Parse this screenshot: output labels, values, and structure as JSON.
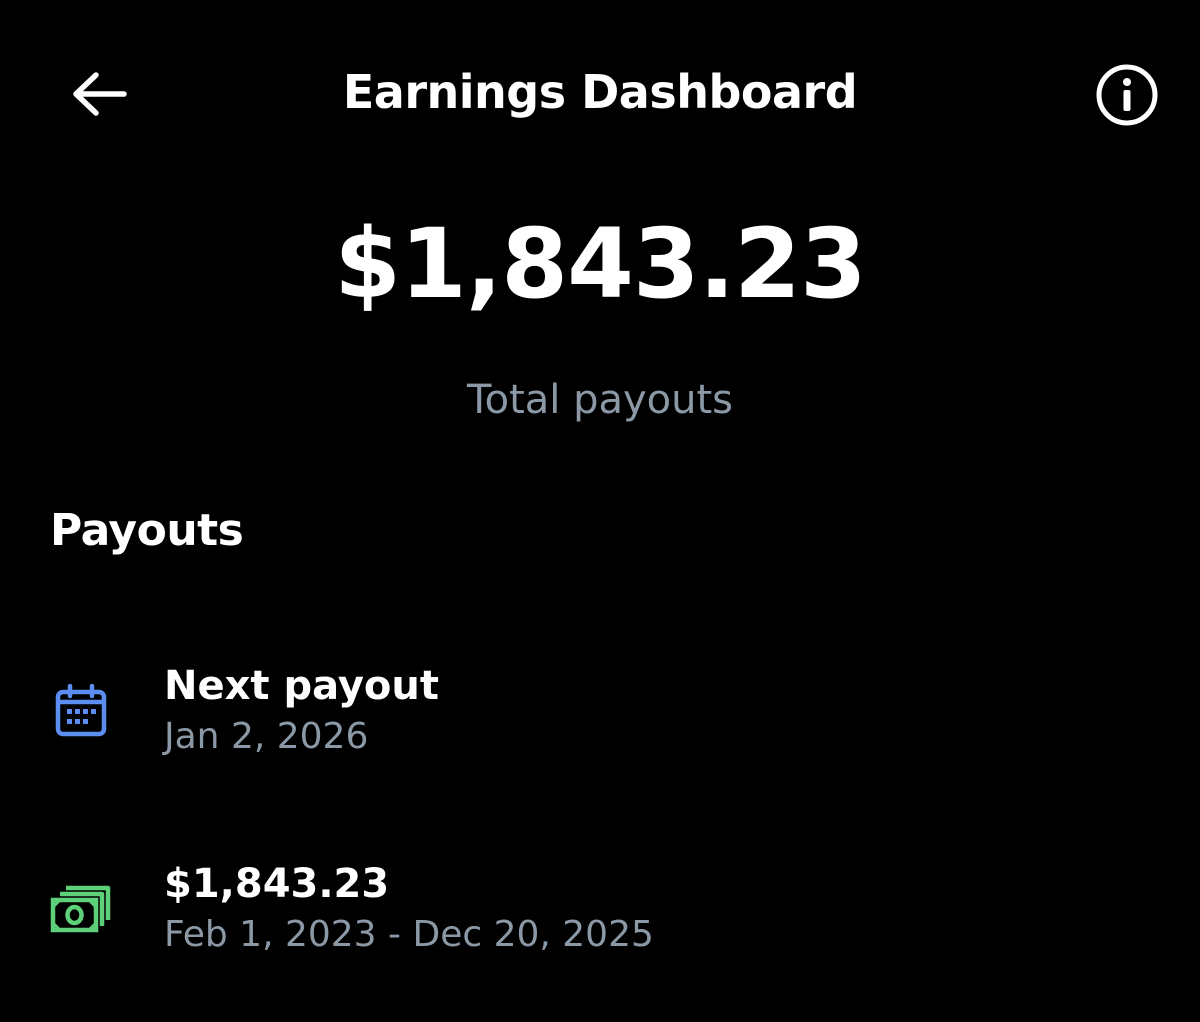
{
  "header": {
    "title": "Earnings Dashboard",
    "back_icon": "arrow-left-icon",
    "info_icon": "info-circle-icon"
  },
  "summary": {
    "total_amount": "$1,843.23",
    "total_label": "Total payouts"
  },
  "payouts": {
    "section_title": "Payouts",
    "items": [
      {
        "icon": "calendar-icon",
        "icon_color": "#5b8ef0",
        "primary": "Next payout",
        "secondary": "Jan 2, 2026"
      },
      {
        "icon": "money-icon",
        "icon_color": "#5fd07a",
        "primary": "$1,843.23",
        "secondary": "Feb 1, 2023 - Dec 20, 2025"
      }
    ]
  },
  "colors": {
    "background": "#000000",
    "text_primary": "#ffffff",
    "text_secondary": "#8b98a5"
  }
}
